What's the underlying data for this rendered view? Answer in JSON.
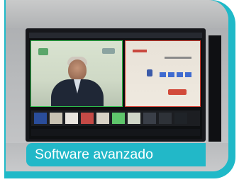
{
  "caption": {
    "text": "Software avanzado"
  },
  "colors": {
    "frame": "#1fb9c8",
    "caption_bg": "#22b8c8",
    "caption_text": "#ffffff",
    "program_outline": "#2ebf4a",
    "preview_outline": "#d33b2e"
  },
  "icons": [
    "person-on-screen",
    "slide-graphic"
  ]
}
